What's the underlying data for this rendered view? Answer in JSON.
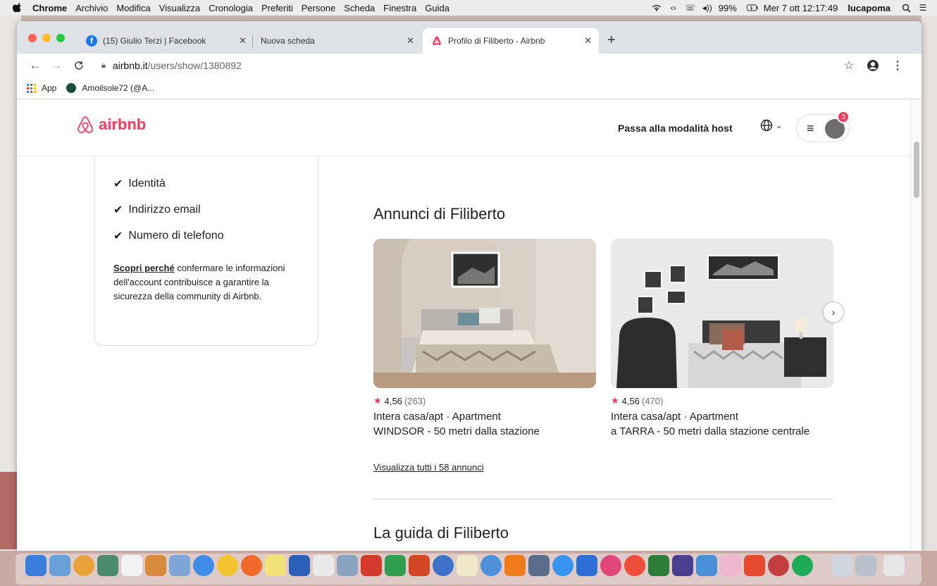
{
  "menubar": {
    "app": "Chrome",
    "items": [
      "Archivio",
      "Modifica",
      "Visualizza",
      "Cronologia",
      "Preferiti",
      "Persone",
      "Scheda",
      "Finestra",
      "Guida"
    ],
    "battery": "99%",
    "datetime": "Mer 7 ott 12:17:49",
    "user": "lucapoma"
  },
  "tabs": [
    {
      "title": "(15) Giulio Terzi | Facebook",
      "icon": "facebook-icon"
    },
    {
      "title": "Nuova scheda",
      "icon": ""
    },
    {
      "title": "Profilo di Filiberto - Airbnb",
      "icon": "airbnb-icon"
    }
  ],
  "address": {
    "host": "airbnb.it",
    "path": "/users/show/1380892"
  },
  "bookmarks": [
    {
      "label": "App",
      "icon": "apps-grid-icon"
    },
    {
      "label": "Amoilsole72 (@A...",
      "icon": "site-icon"
    }
  ],
  "header": {
    "brand": "airbnb",
    "host_link": "Passa alla modalità host",
    "notification_count": "3"
  },
  "verification": {
    "items": [
      "Identità",
      "Indirizzo email",
      "Numero di telefono"
    ],
    "why_link": "Scopri perché",
    "why_text": " confermare le informazioni dell'account contribuisce a garantire la sicurezza della community di Airbnb."
  },
  "listings_title": "Annunci di Filiberto",
  "listings": [
    {
      "rating": "4,56",
      "reviews": "(263)",
      "type": "Intera casa/apt · Apartment",
      "title": "WINDSOR - 50 metri dalla stazione"
    },
    {
      "rating": "4,56",
      "reviews": "(470)",
      "type": "Intera casa/apt · Apartment",
      "title": "a TARRA - 50 metri dalla stazione centrale"
    }
  ],
  "view_all": "Visualizza tutti i 58 annunci",
  "guide_title": "La guida di Filiberto",
  "colors": {
    "brand": "#ff385c",
    "text": "#222222"
  }
}
